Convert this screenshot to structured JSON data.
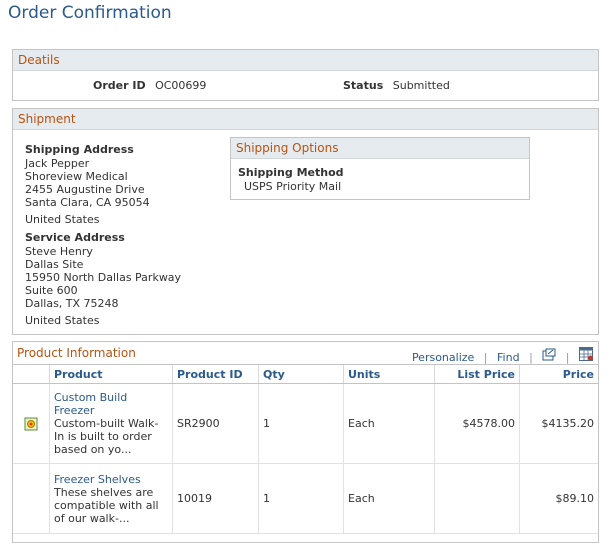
{
  "page_title": "Order Confirmation",
  "details": {
    "header": "Deatils",
    "order_id_label": "Order ID",
    "order_id": "OC00699",
    "status_label": "Status",
    "status": "Submitted"
  },
  "shipment": {
    "header": "Shipment",
    "shipping_address_label": "Shipping Address",
    "shipping_address": [
      "Jack Pepper",
      "Shoreview Medical",
      "2455 Augustine Drive",
      "Santa Clara, CA 95054",
      "United States"
    ],
    "service_address_label": "Service Address",
    "service_address": [
      "Steve Henry",
      "Dallas Site",
      "15950 North Dallas Parkway",
      "Suite 600",
      "Dallas, TX 75248",
      "United States"
    ],
    "shipping_options": {
      "header": "Shipping Options",
      "method_label": "Shipping Method",
      "method": "USPS Priority Mail"
    }
  },
  "products": {
    "header": "Product Information",
    "tools": {
      "personalize": "Personalize",
      "find": "Find"
    },
    "columns": [
      "Product",
      "Product ID",
      "Qty",
      "Units",
      "List Price",
      "Price"
    ],
    "rows": [
      {
        "name": "Custom Build Freezer",
        "description": "Custom-built Walk-In is built to order based on yo...",
        "product_id": "SR2900",
        "qty": "1",
        "units": "Each",
        "list_price": "$4578.00",
        "price": "$4135.20"
      },
      {
        "name": "Freezer Shelves",
        "description": "These shelves are compatible with all of our walk-...",
        "product_id": "10019",
        "qty": "1",
        "units": "Each",
        "list_price": "",
        "price": "$89.10"
      }
    ]
  }
}
